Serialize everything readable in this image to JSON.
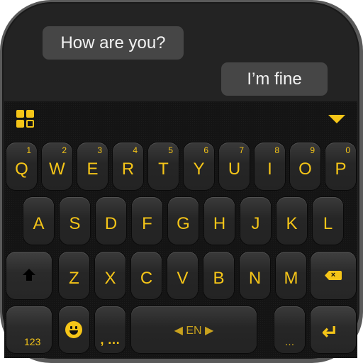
{
  "chat": {
    "incoming": "How are you?",
    "outgoing": "I’m fine"
  },
  "toolbar": {
    "menu_icon": "grid-icon",
    "collapse_icon": "triangle-down-icon"
  },
  "keyboard": {
    "row1": [
      {
        "l": "Q",
        "n": "1"
      },
      {
        "l": "W",
        "n": "2"
      },
      {
        "l": "E",
        "n": "3"
      },
      {
        "l": "R",
        "n": "4"
      },
      {
        "l": "T",
        "n": "5"
      },
      {
        "l": "Y",
        "n": "6"
      },
      {
        "l": "U",
        "n": "7"
      },
      {
        "l": "I",
        "n": "8"
      },
      {
        "l": "O",
        "n": "9"
      },
      {
        "l": "P",
        "n": "0"
      }
    ],
    "row2": [
      "A",
      "S",
      "D",
      "F",
      "G",
      "H",
      "J",
      "K",
      "L"
    ],
    "row3": [
      "Z",
      "X",
      "C",
      "V",
      "B",
      "N",
      "M"
    ],
    "numbers_label": "123",
    "comma_label": ",",
    "comma_sub": "…",
    "space_label": "EN",
    "period_sub": "…"
  },
  "colors": {
    "accent": "#f5c518",
    "key": "#2a2a2a",
    "background": "#141414"
  }
}
